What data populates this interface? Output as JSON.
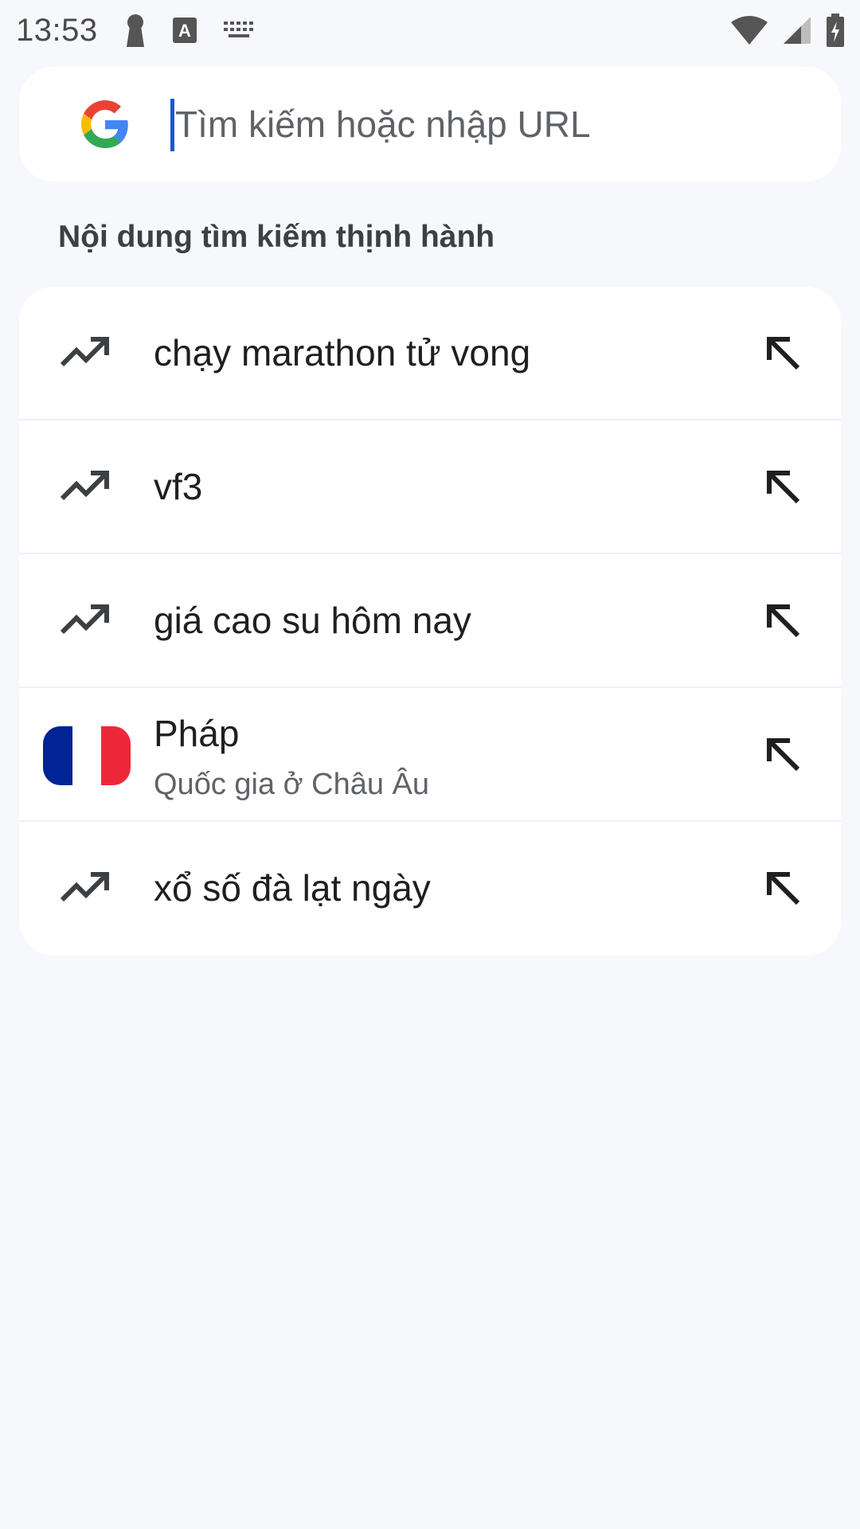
{
  "status_bar": {
    "time": "13:53",
    "icons": [
      "keyhole-icon",
      "a-box-icon",
      "keyboard-icon",
      "wifi-icon",
      "signal-icon",
      "battery-charging-icon"
    ]
  },
  "search": {
    "placeholder": "Tìm kiếm hoặc nhập URL",
    "value": ""
  },
  "trending": {
    "title": "Nội dung tìm kiếm thịnh hành",
    "items": [
      {
        "label": "chạy marathon tử vong",
        "icon": "trending-up-icon"
      },
      {
        "label": "vf3",
        "icon": "trending-up-icon"
      },
      {
        "label": "giá cao su hôm nay",
        "icon": "trending-up-icon"
      },
      {
        "label": "Pháp",
        "sublabel": "Quốc gia ở Châu Âu",
        "icon": "france-flag-icon"
      },
      {
        "label": "xổ số đà lạt ngày",
        "icon": "trending-up-icon"
      }
    ]
  },
  "colors": {
    "background": "#f7f8fc",
    "card": "#ffffff",
    "accent": "#1a56d6",
    "flag_blue": "#002395",
    "flag_white": "#ffffff",
    "flag_red": "#ed2939"
  }
}
